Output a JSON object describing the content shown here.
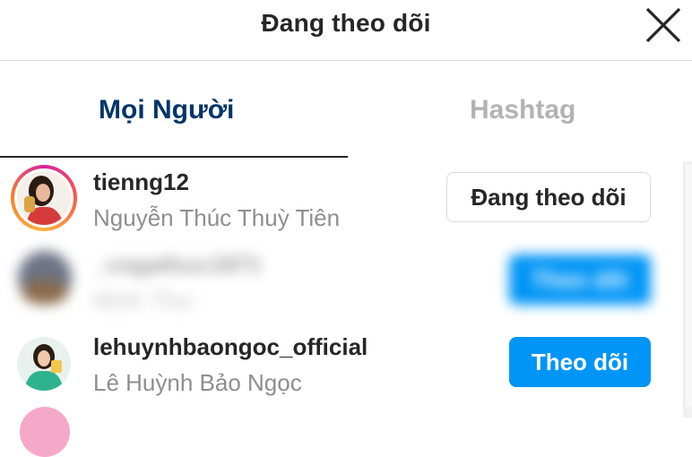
{
  "header": {
    "title": "Đang theo dõi",
    "close_icon": "close-icon"
  },
  "tabs": [
    {
      "label": "Mọi Người",
      "active": true
    },
    {
      "label": "Hashtag",
      "active": false
    }
  ],
  "accounts": [
    {
      "username": "tienng12",
      "full_name": "Nguyễn Thúc Thuỳ Tiên",
      "button_label": "Đang theo dõi",
      "has_story_ring": true
    },
    {
      "username": "_cogathuc1871",
      "full_name": "Minh Thư",
      "button_label": "Theo dõi",
      "blurred": true
    },
    {
      "username": "lehuynhbaongoc_official",
      "full_name": "Lê Huỳnh Bảo Ngọc",
      "button_label": "Theo dõi"
    }
  ],
  "colors": {
    "accent_blue": "#0095f6",
    "active_tab": "#003569",
    "inactive_tab": "#b3b3b3",
    "secondary_text": "#8e8e8e"
  }
}
